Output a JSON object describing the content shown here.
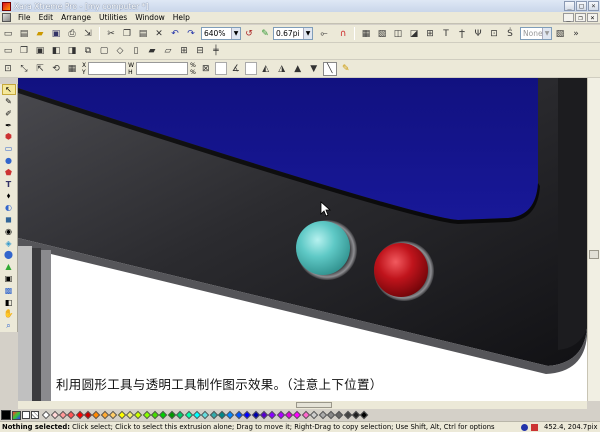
{
  "window": {
    "title": "Xara Xtreme Pro - [my computer *]",
    "controls": [
      "_",
      "□",
      "×"
    ]
  },
  "menu": {
    "items": [
      "File",
      "Edit",
      "Arrange",
      "Utilities",
      "Window",
      "Help"
    ],
    "mdi_controls": [
      "_",
      "❐",
      "×"
    ]
  },
  "toolbar": {
    "zoom": "640%",
    "line_width": "0.67pi",
    "style_field": "None"
  },
  "toolbar2_labels": {
    "w": "W",
    "h": "H",
    "x": "X",
    "y": "Y",
    "pct_w": "%",
    "pct_h": "%"
  },
  "canvas": {
    "caption": "利用圆形工具与透明工具制作图示效果。（注意上下位置）",
    "colors": {
      "screen": "#14148c",
      "bezel": "#2a2a2d",
      "cyan_button": "#5fc9c6",
      "red_button": "#c0141c"
    }
  },
  "status": {
    "message_bold": "Nothing selected:",
    "message": " Click select; Click to select this extrusion alone; Drag to move it; Right-Drag to copy selection; Use Shift, Alt, Ctrl for options",
    "coords": "452.4, 204.7pix"
  },
  "palette_colors": [
    "#ffffff",
    "#ffd6d6",
    "#ff9999",
    "#ff5555",
    "#ff0000",
    "#cc0000",
    "#ff8800",
    "#ffaa33",
    "#ffcc66",
    "#ffff00",
    "#eeee66",
    "#ccff00",
    "#88ff00",
    "#44dd00",
    "#00cc00",
    "#009900",
    "#00cc66",
    "#00ffaa",
    "#00ffff",
    "#66dddd",
    "#33aaaa",
    "#008888",
    "#0088ff",
    "#0055ff",
    "#0000ff",
    "#0000aa",
    "#5500cc",
    "#8800ff",
    "#aa00ff",
    "#dd00dd",
    "#ff00ff",
    "#ff66cc",
    "#cccccc",
    "#aaaaaa",
    "#888888",
    "#666666",
    "#444444",
    "#222222",
    "#000000"
  ]
}
